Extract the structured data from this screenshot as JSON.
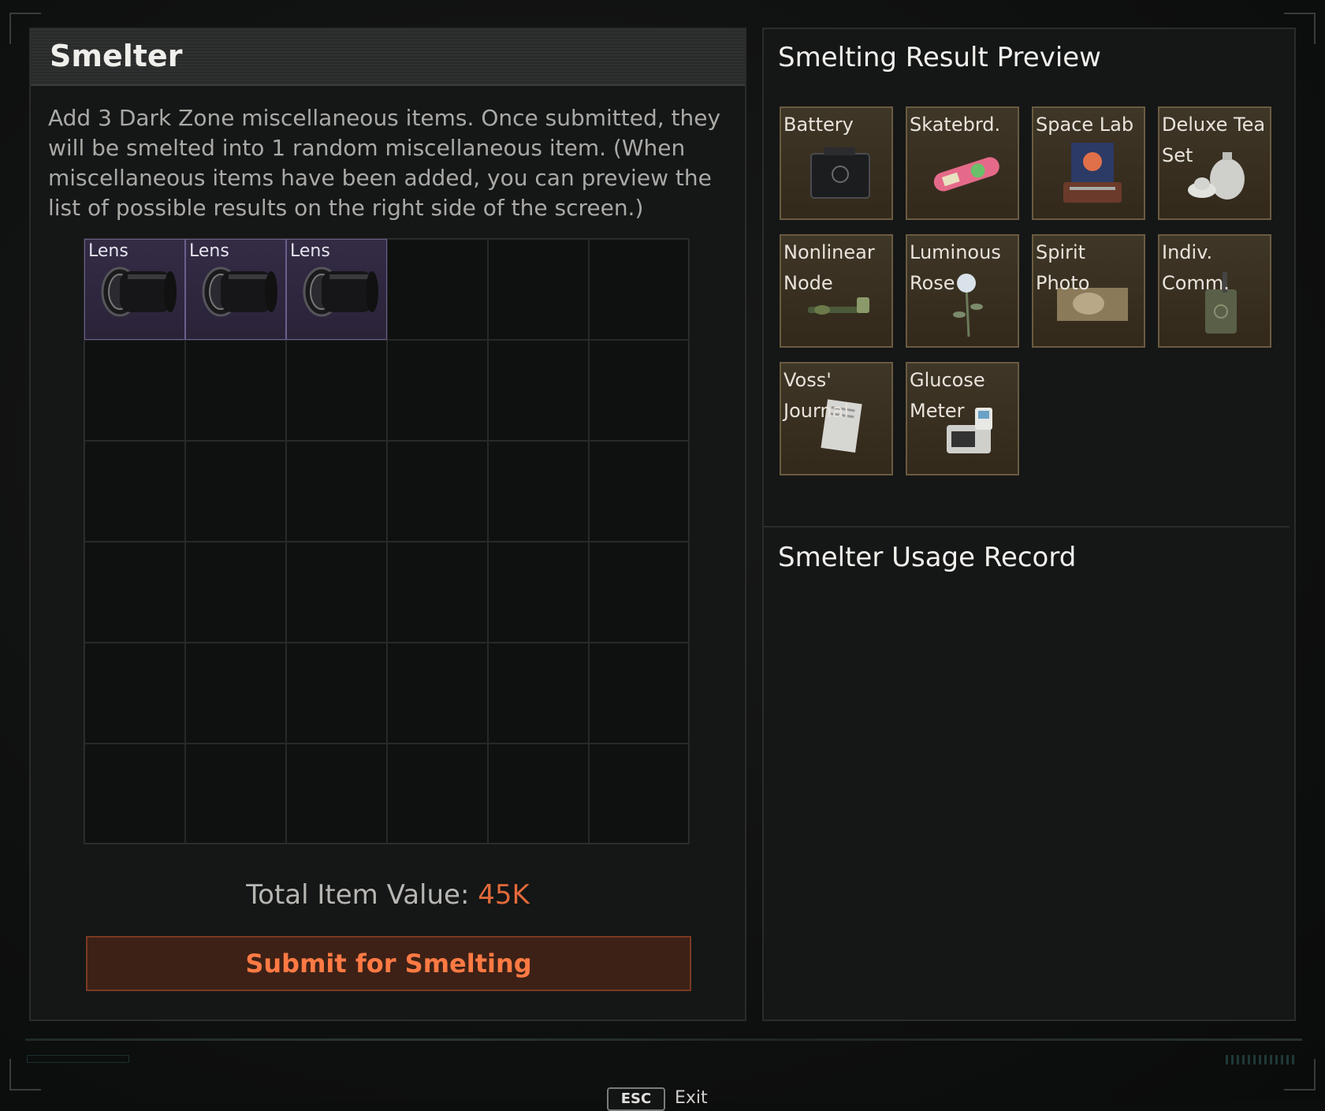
{
  "smelter": {
    "title": "Smelter",
    "description": "Add 3 Dark Zone miscellaneous items. Once submitted, they will be smelted into 1 random miscellaneous item. (When miscellaneous items have been added, you can preview the list of possible results on the right side of the screen.)",
    "slots": [
      {
        "label": "Lens",
        "icon": "lens-icon"
      },
      {
        "label": "Lens",
        "icon": "lens-icon"
      },
      {
        "label": "Lens",
        "icon": "lens-icon"
      }
    ],
    "total_label": "Total Item Value:",
    "total_value": "45K",
    "submit_label": "Submit for Smelting"
  },
  "preview": {
    "title": "Smelting Result Preview",
    "items": [
      {
        "label": "Battery",
        "icon": "battery-icon"
      },
      {
        "label": "Skatebrd.",
        "icon": "skateboard-icon"
      },
      {
        "label": "Space Lab",
        "icon": "space-lab-icon"
      },
      {
        "label": "Deluxe Tea\nSet",
        "icon": "tea-set-icon"
      },
      {
        "label": "Nonlinear\nNode",
        "icon": "node-icon"
      },
      {
        "label": "Luminous\nRose",
        "icon": "rose-icon"
      },
      {
        "label": "Spirit\nPhoto",
        "icon": "photo-icon"
      },
      {
        "label": "Indiv.\nComm.",
        "icon": "comm-icon"
      },
      {
        "label": "Voss'\nJournal",
        "icon": "journal-icon"
      },
      {
        "label": "Glucose\nMeter",
        "icon": "glucose-meter-icon"
      }
    ]
  },
  "usage": {
    "title": "Smelter Usage Record"
  },
  "footer": {
    "key": "ESC",
    "label": "Exit"
  },
  "colors": {
    "accent": "#e26a3a",
    "slot_filled": "#342b45",
    "preview_item": "#3e3627"
  }
}
